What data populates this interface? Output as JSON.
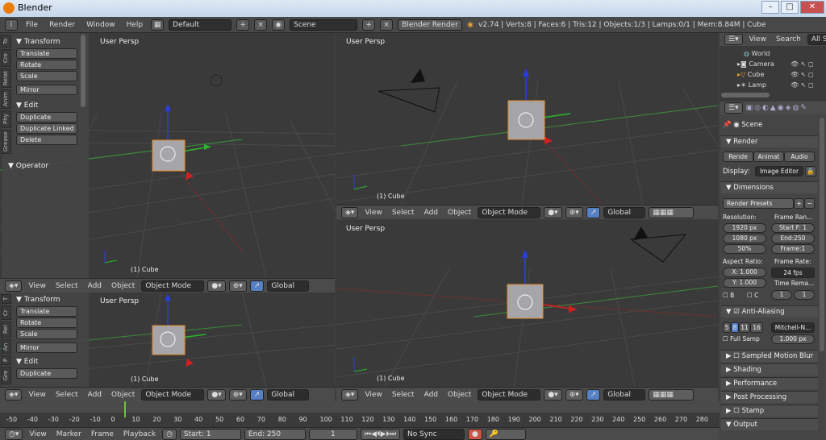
{
  "window": {
    "title": "Blender",
    "minimize": "–",
    "maximize": "□",
    "close": "✕"
  },
  "info": {
    "menus": [
      "File",
      "Render",
      "Window",
      "Help"
    ],
    "layout": "Default",
    "scene": "Scene",
    "engine": "Blender Render",
    "stats": "v2.74 | Verts:8 | Faces:6 | Tris:12 | Objects:1/3 | Lamps:0/1 | Mem:8.84M | Cube"
  },
  "viewports": {
    "persp_label": "User Persp",
    "object_label": "(1) Cube",
    "header": {
      "menus": [
        "View",
        "Select",
        "Add",
        "Object"
      ],
      "mode": "Object Mode",
      "orientation": "Global"
    }
  },
  "toolshelf": {
    "transform_title": "Transform",
    "transform_buttons": [
      "Translate",
      "Rotate",
      "Scale"
    ],
    "mirror": "Mirror",
    "edit_title": "Edit",
    "edit_buttons": [
      "Duplicate",
      "Duplicate Linked",
      "Delete"
    ],
    "operator_title": "Operator",
    "tabs_top": [
      "To",
      "Cre",
      "Relat",
      "Anim",
      "Phy",
      "Grease"
    ],
    "tabs_bottom": [
      "T",
      "Cr",
      "Rel",
      "An",
      "P",
      "Gre"
    ]
  },
  "outliner": {
    "menus": [
      "View",
      "Search",
      "All Scenes"
    ],
    "items": [
      "World",
      "Camera",
      "Cube",
      "Lamp"
    ]
  },
  "properties": {
    "scene": "Scene",
    "render_title": "Render",
    "render_buttons": [
      "Rende",
      "Animat",
      "Audio"
    ],
    "display_label": "Display:",
    "display_value": "Image Editor",
    "dimensions_title": "Dimensions",
    "presets": "Render Presets",
    "resolution_label": "Resolution:",
    "frame_range_label": "Frame Ran...",
    "res_x": "1920 px",
    "res_y": "1080 px",
    "res_pct": "50%",
    "start": "Start F: 1",
    "end": "End:250",
    "frame": "Frame:1",
    "aspect_label": "Aspect Ratio:",
    "framerate_label": "Frame Rate:",
    "aspect_x": "X: 1.000",
    "aspect_y": "Y: 1.000",
    "fps": "24 fps",
    "time_remap_label": "Time Rema...",
    "b_label": "B",
    "c_label": "C",
    "remap_a": "1",
    "remap_b": "1",
    "aa_title": "Anti-Aliasing",
    "aa_samples": [
      "5",
      "8",
      "11",
      "16"
    ],
    "aa_filter": "Mitchell-N...",
    "full_sample": "Full Samp",
    "filter_size": "1.000 px",
    "collapsed_sections": [
      "Sampled Motion Blur",
      "Shading",
      "Performance",
      "Post Processing",
      "Stamp",
      "Output"
    ]
  },
  "timeline": {
    "ticks": [
      "-50",
      "-40",
      "-30",
      "-20",
      "-10",
      "0",
      "10",
      "20",
      "30",
      "40",
      "50",
      "60",
      "70",
      "80",
      "90",
      "100",
      "110",
      "120",
      "130",
      "140",
      "150",
      "160",
      "170",
      "180",
      "190",
      "200",
      "210",
      "220",
      "230",
      "240",
      "250",
      "260",
      "270",
      "280"
    ],
    "menus": [
      "View",
      "Marker",
      "Frame",
      "Playback"
    ],
    "start": "Start:",
    "start_val": "1",
    "end": "End:",
    "end_val": "250",
    "current": "1",
    "sync": "No Sync"
  }
}
